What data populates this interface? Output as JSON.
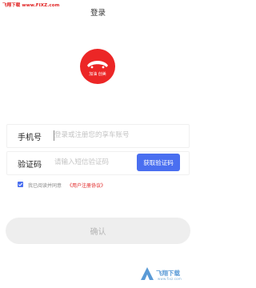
{
  "watermark": {
    "url_text": "飞翔下载 www.FIXZ.com",
    "brand_text": "飞翔下载",
    "brand_sub": "www.fixz.com"
  },
  "header": {
    "title": "登录"
  },
  "logo": {
    "text": "加油 创美",
    "color": "#ec2626"
  },
  "form": {
    "phone": {
      "label": "手机号",
      "value": "",
      "placeholder": "登录或注册您的享车账号"
    },
    "code": {
      "label": "验证码",
      "value": "",
      "placeholder": "请输入短信验证码"
    },
    "sms_button_label": "获取验证码"
  },
  "agreement": {
    "checked": true,
    "text": "我已阅读并同意",
    "link_text": "《用户注册协议》"
  },
  "confirm_button_label": "确认",
  "colors": {
    "accent": "#4a6ff0",
    "link": "#e02020",
    "button_disabled_bg": "#eeeeee",
    "button_disabled_text": "#b4b4b4"
  },
  "icons": {
    "logo": "car-logo-icon",
    "checkbox": "checkbox-checked-icon",
    "watermark": "watermark-logo-icon"
  }
}
